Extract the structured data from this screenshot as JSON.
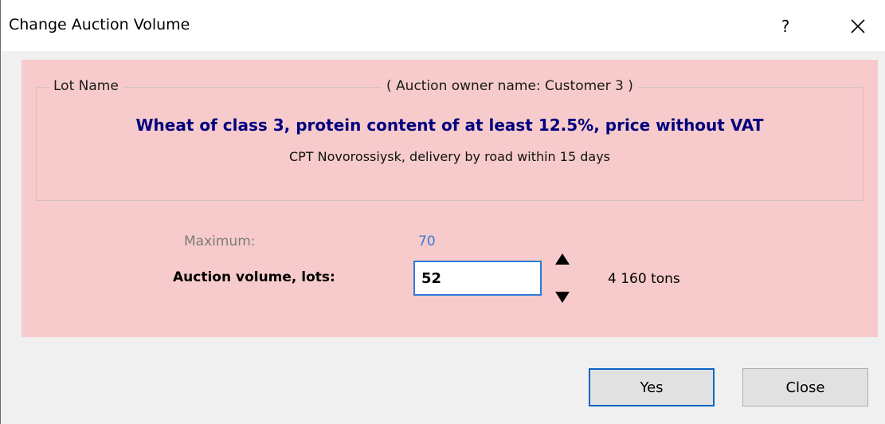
{
  "window": {
    "title": "Change Auction Volume",
    "help_label": "?",
    "close_icon": "close-icon"
  },
  "lot": {
    "group_label": "Lot Name",
    "owner_label": "( Auction owner name: Customer 3 )",
    "title": "Wheat of class 3, protein content of at least 12.5%, price without VAT",
    "subtitle": "CPT Novorossiysk, delivery by road within 15 days"
  },
  "volume": {
    "max_label": "Maximum:",
    "max_value": "70",
    "label": "Auction volume, lots:",
    "value": "52",
    "tons": "4 160 tons",
    "spin_up_icon": "triangle-up-icon",
    "spin_down_icon": "triangle-down-icon"
  },
  "buttons": {
    "yes": "Yes",
    "close": "Close"
  },
  "colors": {
    "panel_background": "#f7cbcb",
    "lot_title": "#00007f",
    "max_value": "#3a7bd5",
    "focus_border": "#2a7ad8"
  }
}
